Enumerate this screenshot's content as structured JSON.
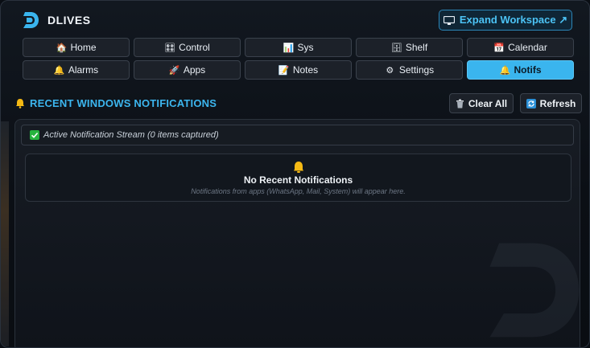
{
  "app": {
    "name": "DLIVES"
  },
  "header": {
    "expand_label": "Expand Workspace ↗",
    "expand_icon": "monitor-icon"
  },
  "tabs": [
    {
      "label": "Home",
      "icon": "🏠"
    },
    {
      "label": "Control",
      "icon": "🎛"
    },
    {
      "label": "Sys",
      "icon": "📊"
    },
    {
      "label": "Shelf",
      "icon": "🗄"
    },
    {
      "label": "Calendar",
      "icon": "📅"
    },
    {
      "label": "Alarms",
      "icon": "🔔"
    },
    {
      "label": "Apps",
      "icon": "🚀"
    },
    {
      "label": "Notes",
      "icon": "📝"
    },
    {
      "label": "Settings",
      "icon": "⚙"
    },
    {
      "label": "Notifs",
      "icon": "🔔",
      "active": true
    }
  ],
  "section": {
    "title": "RECENT WINDOWS NOTIFICATIONS"
  },
  "actions": {
    "clear_label": "Clear All",
    "refresh_label": "Refresh"
  },
  "stream": {
    "status": "Active Notification Stream (0 items captured)"
  },
  "empty_state": {
    "title": "No Recent Notifications",
    "subtitle": "Notifications from apps (WhatsApp, Mail, System) will appear here."
  },
  "colors": {
    "accent": "#3ab5ee",
    "active_tab_text": "#0b1a26",
    "check": "#27b33f",
    "bell": "#f5b914"
  }
}
